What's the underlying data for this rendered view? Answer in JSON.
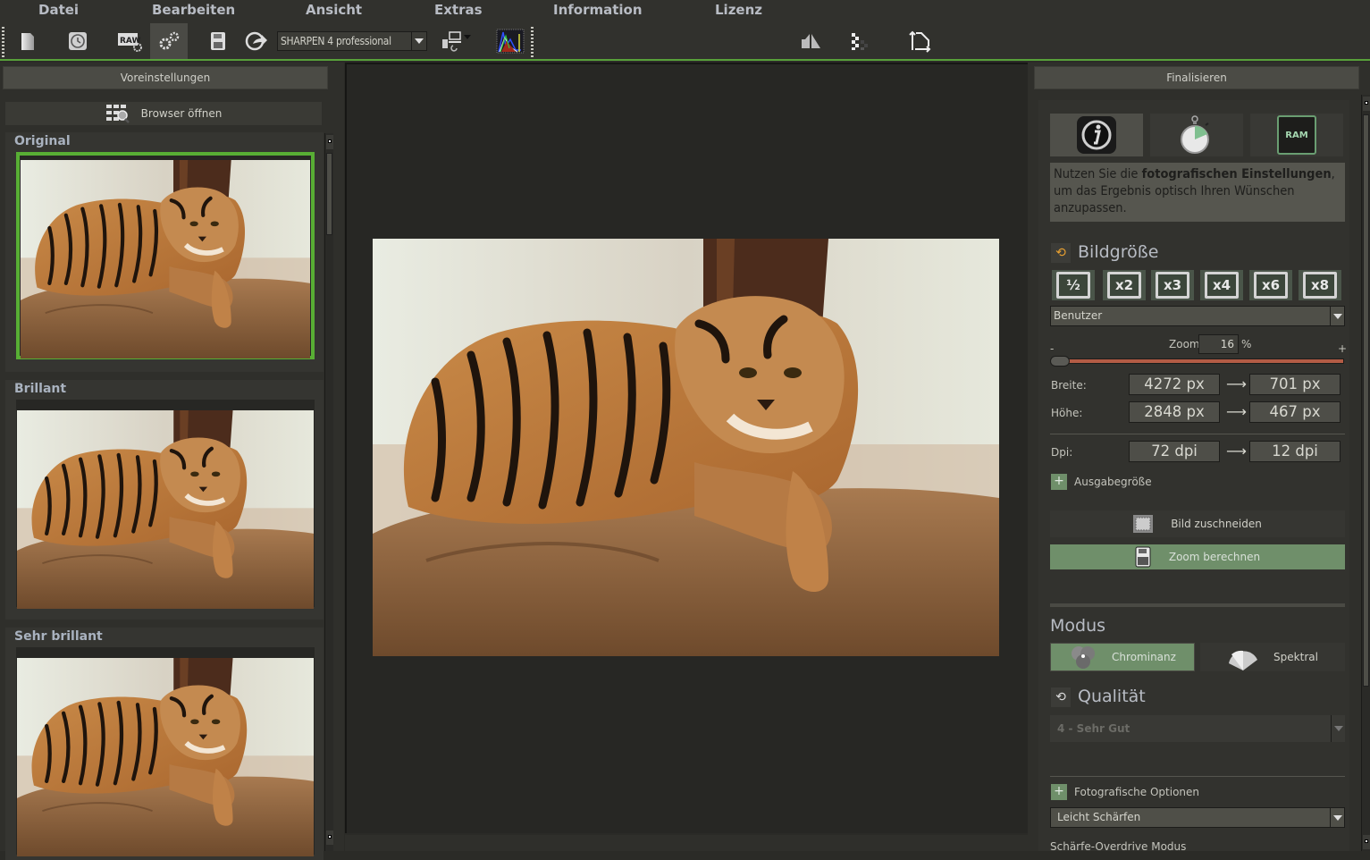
{
  "menu": [
    "Datei",
    "Bearbeiten",
    "Ansicht",
    "Extras",
    "Information",
    "Lizenz"
  ],
  "toolbar": {
    "buttons": [
      {
        "name": "new-file",
        "active": false
      },
      {
        "name": "history",
        "active": false
      },
      {
        "name": "raw-settings",
        "active": false
      },
      {
        "name": "settings",
        "active": true
      },
      {
        "name": "save",
        "active": false
      },
      {
        "name": "export",
        "active": false
      }
    ],
    "preset_value": "SHARPEN 4 professional",
    "right_buttons": [
      "compare-split",
      "pixel-view",
      "rotate-crop"
    ]
  },
  "left_panel": {
    "header": "Voreinstellungen",
    "browser_button": "Browser öffnen",
    "presets": [
      {
        "title": "Original",
        "selected": true
      },
      {
        "title": "Brillant",
        "selected": false
      },
      {
        "title": "Sehr brillant",
        "selected": false
      }
    ]
  },
  "right_panel": {
    "header": "Finalisieren",
    "tabs": [
      "info",
      "timer",
      "ram"
    ],
    "ram_label": "RAM",
    "info_text": {
      "part1": "Nutzen Sie die ",
      "bold": "fotografischen Einstellungen",
      "part2": ", um das Ergebnis optisch Ihren Wünschen anzupassen."
    },
    "bildgroesse": {
      "title": "Bildgröße",
      "size_buttons": [
        "½",
        "x2",
        "x3",
        "x4",
        "x6",
        "x8"
      ],
      "preset": "Benutzer",
      "zoom_label": "Zoom",
      "zoom_value": "16",
      "zoom_unit": "%",
      "slider_minus": "-",
      "slider_plus": "+",
      "zoom_slider_fraction": 0.0,
      "breite_label": "Breite:",
      "breite_from": "4272 px",
      "breite_to": "701 px",
      "hoehe_label": "Höhe:",
      "hoehe_from": "2848 px",
      "hoehe_to": "467 px",
      "dpi_label": "Dpi:",
      "dpi_from": "72 dpi",
      "dpi_to": "12 dpi",
      "arrow": "⟶",
      "ausgabe_label": "Ausgabegröße",
      "crop_button": "Bild zuschneiden",
      "compute_button": "Zoom berechnen"
    },
    "modus": {
      "title": "Modus",
      "options": [
        "Chrominanz",
        "Spektral"
      ],
      "selected": "Chrominanz"
    },
    "qualitaet": {
      "title": "Qualität",
      "value": "4 - Sehr Gut"
    },
    "fotografische": {
      "label": "Fotografische Optionen",
      "value": "Leicht Schärfen",
      "next_label": "Schärfe-Overdrive Modus"
    }
  },
  "colors": {
    "accent_green": "#58ae34",
    "button_green": "#6f8f6a",
    "slider_red": "#b35c45"
  }
}
